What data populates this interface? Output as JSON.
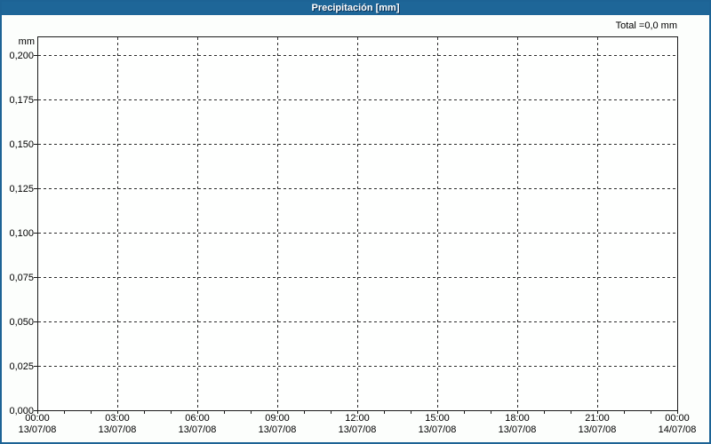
{
  "header": {
    "title": "Precipitación [mm]"
  },
  "summary": {
    "total_label": "Total =0,0 mm"
  },
  "chart_data": {
    "type": "bar",
    "title": "Precipitación [mm]",
    "ylabel": "mm",
    "xlabel": "",
    "total_text": "Total =0,0 mm",
    "total_mm": 0.0,
    "grid": true,
    "legend": "none",
    "ylim": [
      0,
      0.2105
    ],
    "y_ticks": [
      {
        "value": 0.2,
        "label": "0,200"
      },
      {
        "value": 0.175,
        "label": "0,175"
      },
      {
        "value": 0.15,
        "label": "0,150"
      },
      {
        "value": 0.125,
        "label": "0,125"
      },
      {
        "value": 0.1,
        "label": "0,100"
      },
      {
        "value": 0.075,
        "label": "0,075"
      },
      {
        "value": 0.05,
        "label": "0,050"
      },
      {
        "value": 0.025,
        "label": "0,025"
      },
      {
        "value": 0.0,
        "label": "0,000"
      }
    ],
    "x_ticks": [
      {
        "time": "00:00",
        "date": "13/07/08"
      },
      {
        "time": "03:00",
        "date": "13/07/08"
      },
      {
        "time": "06:00",
        "date": "13/07/08"
      },
      {
        "time": "09:00",
        "date": "13/07/08"
      },
      {
        "time": "12:00",
        "date": "13/07/08"
      },
      {
        "time": "15:00",
        "date": "13/07/08"
      },
      {
        "time": "18:00",
        "date": "13/07/08"
      },
      {
        "time": "21:00",
        "date": "13/07/08"
      },
      {
        "time": "00:00",
        "date": "14/07/08"
      }
    ],
    "hours_span": 24,
    "minor_tick_hours": 1,
    "grid_hours": 3,
    "series": [
      {
        "name": "Precipitación",
        "values": []
      }
    ],
    "colors": {
      "header_bg": "#1e6698",
      "border": "#1d6395",
      "axis": "#1a1a1a",
      "grid": "#2a2a2a",
      "page_bg": "#fcfefc"
    }
  }
}
